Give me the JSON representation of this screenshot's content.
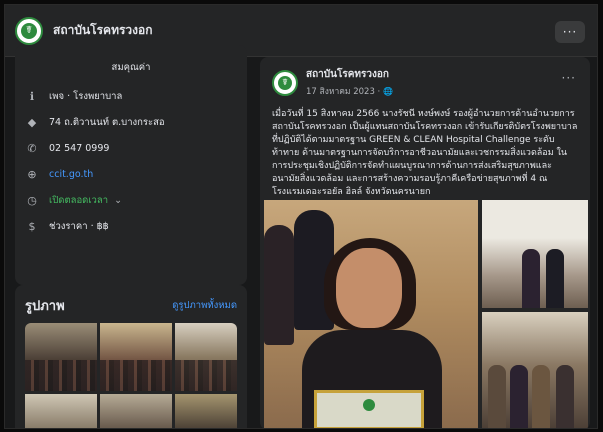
{
  "page": {
    "name": "สถาบันโรคทรวงอก",
    "more_label": "···",
    "logo_glyph": "☤"
  },
  "intro": {
    "text": "สมคุณค่า"
  },
  "info": [
    {
      "icon": "info-icon",
      "glyph": "ℹ",
      "text": "เพจ · โรงพยาบาล",
      "style": "normal"
    },
    {
      "icon": "location-icon",
      "glyph": "◆",
      "text": "74 ถ.ติวานนท์ ต.บางกระสอ",
      "style": "normal"
    },
    {
      "icon": "phone-icon",
      "glyph": "✆",
      "text": "02 547 0999",
      "style": "normal"
    },
    {
      "icon": "globe-icon",
      "glyph": "⊕",
      "text": "ccit.go.th",
      "style": "link"
    },
    {
      "icon": "clock-icon",
      "glyph": "◷",
      "text": "เปิดตลอดเวลา",
      "style": "green",
      "chevron": "⌄"
    },
    {
      "icon": "price-icon",
      "glyph": "$",
      "text": "ช่วงราคา · ฿฿",
      "style": "normal"
    }
  ],
  "photos": {
    "title": "รูปภาพ",
    "see_all": "ดูรูปภาพทั้งหมด"
  },
  "post": {
    "author": "สถาบันโรคทรวงอก",
    "date": "17 สิงหาคม 2023 · ",
    "privacy_glyph": "🌐",
    "more_label": "···",
    "body": "เมื่อวันที่ 15 สิงหาคม 2566 นางรัชนี หงษ์พงษ์ รองผู้อำนวยการด้านอำนวยการ สถาบันโรคทรวงอก เป็นผู้แทนสถาบันโรคทรวงอก เข้ารับเกียรติบัตรโรงพยาบาลที่ปฏิบัติได้ตามมาตรฐาน GREEN & CLEAN Hospital Challenge ระดับท้าทาย ด้านมาตรฐานการจัดบริการอาชีวอนามัยและเวชกรรมสิ่งแวดล้อม ในการประชุมเชิงปฏิบัติการจัดทำแผนบูรณาการด้านการส่งเสริมสุขภาพและอนามัยสิ่งแวดล้อม และการสร้างความรอบรู้ภาคีเครือข่ายสุขภาพที่ 4 ณ โรงแรมเดอะรอยัล ฮิลล์ จังหวัดนครนายก"
  },
  "colors": {
    "background": "#18191a",
    "card": "#242526",
    "link": "#4599ff",
    "open_green": "#45bd62",
    "brand_green": "#2e8b3e"
  }
}
